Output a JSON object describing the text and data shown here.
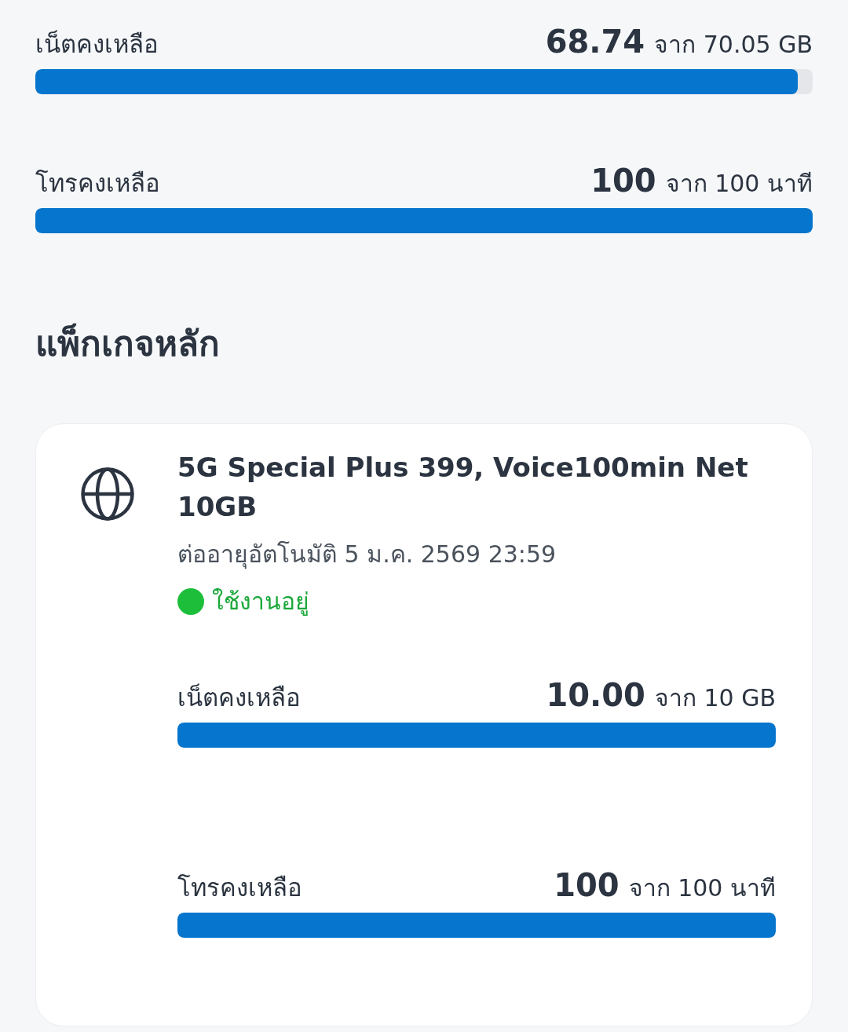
{
  "summary": [
    {
      "label": "เน็ตคงเหลือ",
      "remaining": "68.74",
      "total": "จาก 70.05 GB",
      "level": 0.981
    },
    {
      "label": "โทรคงเหลือ",
      "remaining": "100",
      "total": "จาก 100 นาที",
      "level": 1
    }
  ],
  "section_title": "แพ็กเกจหลัก",
  "package": {
    "name": "5G Special Plus 399, Voice100min Net 10GB",
    "renewal": "ต่ออายุอัตโนมัติ 5 ม.ค. 2569 23:59",
    "status": {
      "label": "ใช้งานอยู่",
      "active": true
    },
    "quotas": [
      {
        "label": "เน็ตคงเหลือ",
        "remaining": "10.00",
        "total": "จาก 10 GB",
        "level": 1
      },
      {
        "label": "โทรคงเหลือ",
        "remaining": "100",
        "total": "จาก 100 นาที",
        "level": 1
      }
    ]
  }
}
